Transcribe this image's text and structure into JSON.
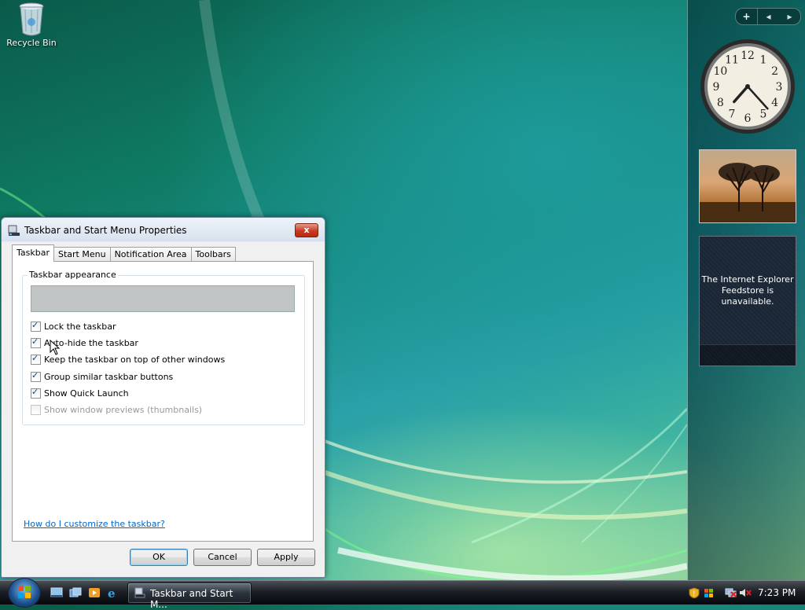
{
  "desktop": {
    "icons": [
      {
        "label": "Recycle Bin",
        "icon": "recycle-bin-icon"
      }
    ]
  },
  "sidebar": {
    "controls": {
      "add": "+",
      "prev": "◂",
      "next": "▸"
    },
    "clock": {
      "numerals": [
        "12",
        "1",
        "2",
        "3",
        "4",
        "5",
        "6",
        "7",
        "8",
        "9",
        "10",
        "11"
      ],
      "hour": 7,
      "minute": 23
    },
    "feed_message": "The Internet Explorer Feedstore is unavailable."
  },
  "dialog": {
    "title": "Taskbar and Start Menu Properties",
    "close": "x",
    "tabs": [
      "Taskbar",
      "Start Menu",
      "Notification Area",
      "Toolbars"
    ],
    "active_tab": 0,
    "group_title": "Taskbar appearance",
    "checkboxes": [
      {
        "label": "Lock the taskbar",
        "checked": true,
        "enabled": true
      },
      {
        "label": "Auto-hide the taskbar",
        "checked": true,
        "enabled": true
      },
      {
        "label": "Keep the taskbar on top of other windows",
        "checked": true,
        "enabled": true
      },
      {
        "label": "Group similar taskbar buttons",
        "checked": true,
        "enabled": true
      },
      {
        "label": "Show Quick Launch",
        "checked": true,
        "enabled": true
      },
      {
        "label": "Show window previews (thumbnails)",
        "checked": false,
        "enabled": false
      }
    ],
    "help_link": "How do I customize the taskbar?",
    "buttons": {
      "ok": "OK",
      "cancel": "Cancel",
      "apply": "Apply"
    }
  },
  "taskbar": {
    "window_button": "Taskbar and Start M...",
    "clock": "7:23 PM"
  },
  "colors": {
    "accent": "#3c7fb1",
    "link": "#0066cc",
    "close": "#c83a22"
  }
}
